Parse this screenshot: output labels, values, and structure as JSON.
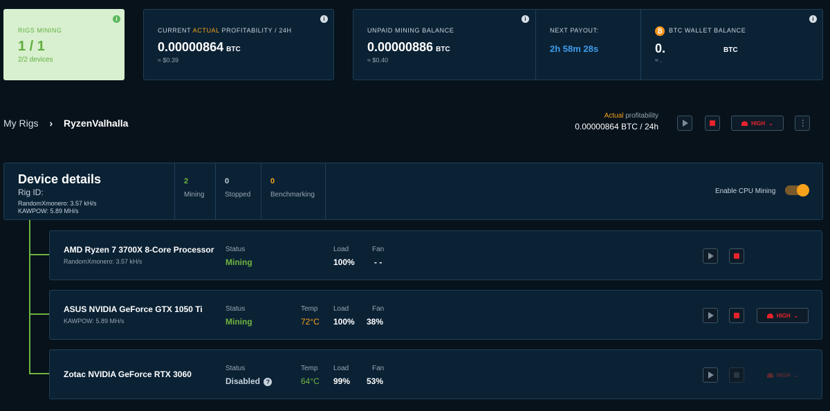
{
  "summary": {
    "rigs_mining": {
      "label": "RIGS MINING",
      "value": "1 / 1",
      "sub": "2/2 devices"
    },
    "profitability": {
      "label_prefix": "CURRENT",
      "label_accent": "ACTUAL",
      "label_suffix": "PROFITABILITY / 24H",
      "value": "0.00000864",
      "unit": "BTC",
      "usd": "≈ $0.39"
    },
    "unpaid": {
      "label": "UNPAID MINING BALANCE",
      "value": "0.00000886",
      "unit": "BTC",
      "usd": "≈ $0.40"
    },
    "next_payout": {
      "label": "NEXT PAYOUT:",
      "value": "2h 58m 28s"
    },
    "wallet": {
      "label": "BTC WALLET BALANCE",
      "value": "0.",
      "unit": "BTC",
      "usd": "≈ ."
    }
  },
  "breadcrumb": {
    "root": "My Rigs",
    "separator": "›",
    "current": "RyzenValhalla"
  },
  "rig_header": {
    "profit_accent": "Actual",
    "profit_label": "profitability",
    "profit_value": "0.00000864 BTC / 24h",
    "power_mode": "HIGH"
  },
  "device_details": {
    "title": "Device details",
    "rig_id_label": "Rig ID:",
    "algo1": "RandomXmonero: 3.57 kH/s",
    "algo2": "KAWPOW: 5.89 MH/s",
    "stats": [
      {
        "value": "2",
        "label": "Mining"
      },
      {
        "value": "0",
        "label": "Stopped"
      },
      {
        "value": "0",
        "label": "Benchmarking"
      }
    ],
    "cpu_toggle_label": "Enable CPU Mining",
    "cpu_toggle_on": true
  },
  "columns": {
    "status": "Status",
    "temp": "Temp",
    "load": "Load",
    "fan": "Fan"
  },
  "devices": [
    {
      "name": "AMD Ryzen 7 3700X 8-Core Processor",
      "algo": "RandomXmonero: 3.57 kH/s",
      "status": "Mining",
      "temp": "",
      "load": "100%",
      "fan": "- -",
      "power_mode": ""
    },
    {
      "name": "ASUS NVIDIA GeForce GTX 1050 Ti",
      "algo": "KAWPOW: 5.89 MH/s",
      "status": "Mining",
      "temp": "72°C",
      "load": "100%",
      "fan": "38%",
      "power_mode": "HIGH"
    },
    {
      "name": "Zotac NVIDIA GeForce RTX 3060",
      "algo": "",
      "status": "Disabled",
      "temp": "64°C",
      "load": "99%",
      "fan": "53%",
      "power_mode": "HIGH"
    }
  ],
  "colors": {
    "accent_orange": "#f7a21b",
    "mining_green": "#6fb53f",
    "stop_red": "#e8232b",
    "payout_blue": "#3d9be9"
  }
}
